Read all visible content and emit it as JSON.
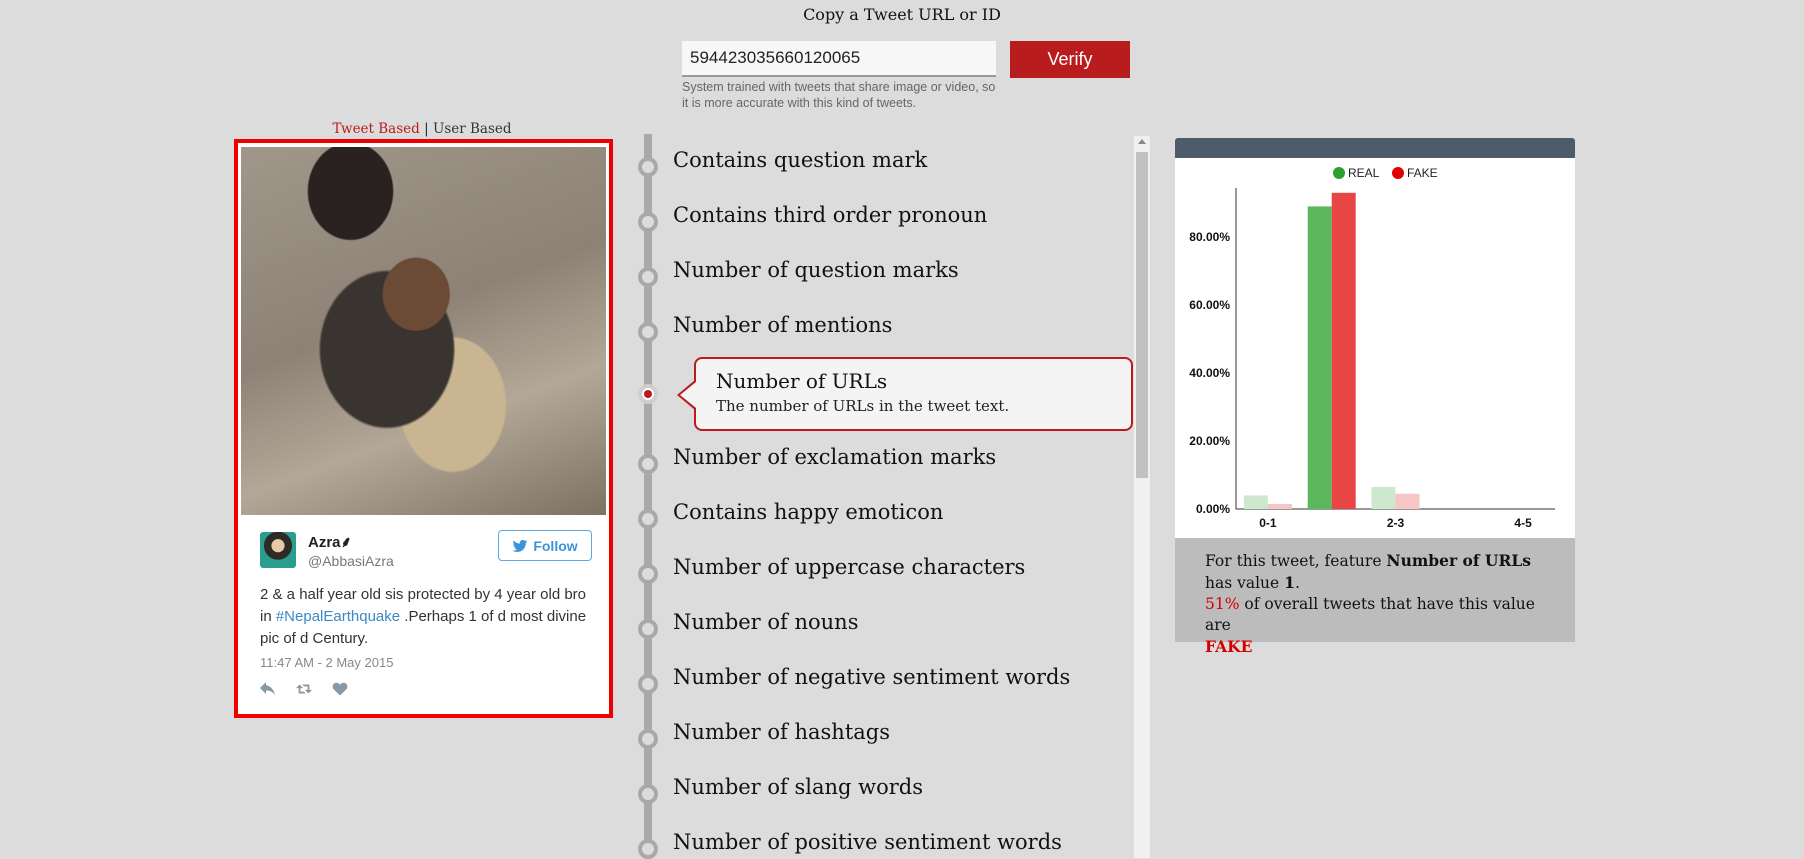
{
  "header": {
    "prompt": "Copy a Tweet URL or ID",
    "input_value": "594423035660120065",
    "verify_label": "Verify",
    "hint": "System trained with tweets that share image or video, so it is more accurate with this kind of tweets."
  },
  "mode_switch": {
    "active": "Tweet Based",
    "separator": " | ",
    "inactive": "User Based"
  },
  "tweet": {
    "name": "Azra⸙",
    "handle": "@AbbasiAzra",
    "follow_label": "Follow",
    "text_before": "2 & a half year old sis protected by 4 year old bro in ",
    "hashtag": "#NepalEarthquake",
    "text_after": " .Perhaps 1 of d most divine pic of d Century.",
    "time": "11:47 AM - 2 May 2015",
    "icons": [
      "reply-icon",
      "retweet-icon",
      "like-icon"
    ]
  },
  "features": [
    {
      "label": "Contains question mark"
    },
    {
      "label": "Contains third order pronoun"
    },
    {
      "label": "Number of question marks"
    },
    {
      "label": "Number of mentions"
    },
    {
      "label": "Number of URLs",
      "description": "The number of URLs in the tweet text.",
      "selected": true
    },
    {
      "label": "Number of exclamation marks"
    },
    {
      "label": "Contains happy emoticon"
    },
    {
      "label": "Number of uppercase characters"
    },
    {
      "label": "Number of nouns"
    },
    {
      "label": "Number of negative sentiment words"
    },
    {
      "label": "Number of hashtags"
    },
    {
      "label": "Number of slang words"
    },
    {
      "label": "Number of positive sentiment words"
    }
  ],
  "chart_data": {
    "type": "bar",
    "categories": [
      "0-1",
      "",
      "2-3",
      "",
      "4-5"
    ],
    "series": [
      {
        "name": "REAL",
        "values": [
          4.0,
          89.0,
          6.5,
          0,
          0
        ],
        "color": "#5cb85c",
        "faded_color": "#cde8cd"
      },
      {
        "name": "FAKE",
        "values": [
          1.5,
          93.0,
          4.5,
          0,
          0
        ],
        "color": "#e84545",
        "faded_color": "#f6c6c6"
      }
    ],
    "highlighted_category_index": 1,
    "y_ticks": [
      "0.00%",
      "20.00%",
      "40.00%",
      "60.00%",
      "80.00%"
    ],
    "y_tick_values": [
      0,
      20,
      40,
      60,
      80
    ],
    "ylim": [
      0,
      95
    ],
    "legend": [
      "REAL",
      "FAKE"
    ],
    "legend_position": "top-center"
  },
  "result": {
    "line1_prefix": "For this tweet, feature ",
    "feature_name": "Number of URLs",
    "line1_suffix": " has value ",
    "value": "1",
    "period": ".",
    "percent": "51%",
    "line2": " of overall tweets that have this value are ",
    "verdict": "FAKE"
  }
}
